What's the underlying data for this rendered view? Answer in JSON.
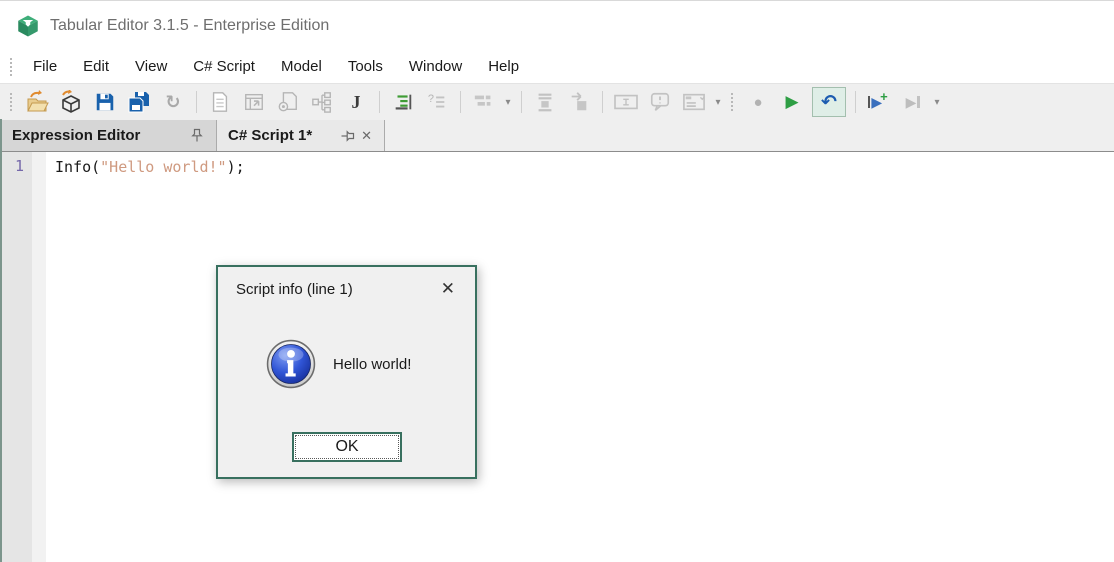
{
  "window": {
    "title": "Tabular Editor 3.1.5 - Enterprise Edition"
  },
  "menu": {
    "items": [
      "File",
      "Edit",
      "View",
      "C# Script",
      "Model",
      "Tools",
      "Window",
      "Help"
    ]
  },
  "toolbar": {
    "button_names": [
      "open-file",
      "open-model",
      "save",
      "save-all",
      "refresh",
      "new-document",
      "import-table",
      "deploy-page",
      "hierarchy",
      "csharp-script",
      "format-document",
      "comment-lines",
      "layout-picker",
      "insert-section",
      "goto-target",
      "text-box",
      "message-bubble",
      "list-box",
      "record-macro",
      "run-script",
      "undo",
      "run-new-script",
      "run-continue"
    ],
    "glyphs": {
      "refresh": "↻",
      "record": "●",
      "run": "▶",
      "undo": "↶",
      "play": "▶",
      "plus": "+",
      "caret": "▾",
      "script": "J",
      "bubble_mark": "!",
      "question": "?"
    }
  },
  "tabs": {
    "panel_caption": "Expression Editor",
    "active_tab_label": "C# Script 1*",
    "close_glyph": "✕"
  },
  "editor": {
    "line_number": "1",
    "code": {
      "fn": "Info(",
      "string": "\"Hello world!\"",
      "end": ");"
    }
  },
  "dialog": {
    "title": "Script info (line 1)",
    "message": "Hello world!",
    "ok_label": "OK",
    "close_glyph": "✕"
  },
  "colors": {
    "accent_teal": "#38705f",
    "save_blue": "#1961ac",
    "run_green": "#2e9e44",
    "string_salmon": "#cf9a80",
    "line_number_purple": "#7568aa",
    "highlight_mint": "#dfeee7"
  }
}
